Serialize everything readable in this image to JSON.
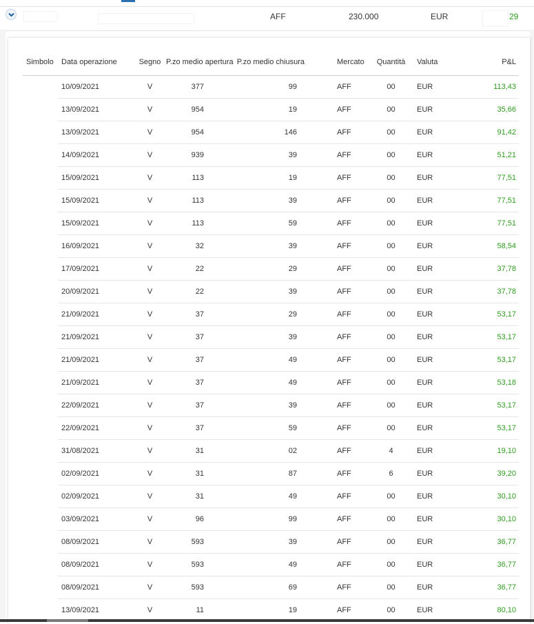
{
  "summary": {
    "market": "AFF",
    "amount": "230.000",
    "currency": "EUR",
    "pnl": "29"
  },
  "table": {
    "headers": {
      "symbol": "Simbolo",
      "date": "Data operazione",
      "sign": "Segno",
      "open_price": "P.zo medio apertura",
      "close_price": "P.zo medio chiusura",
      "market": "Mercato",
      "quantity": "Quantità",
      "currency": "Valuta",
      "pnl": "P&L"
    },
    "rows": [
      {
        "date": "10/09/2021",
        "sign": "V",
        "open": "377",
        "close": "99",
        "market": "AFF",
        "qty": "00",
        "currency": "EUR",
        "pnl": "113,43"
      },
      {
        "date": "13/09/2021",
        "sign": "V",
        "open": "954",
        "close": "19",
        "market": "AFF",
        "qty": "00",
        "currency": "EUR",
        "pnl": "35,66"
      },
      {
        "date": "13/09/2021",
        "sign": "V",
        "open": "954",
        "close": "146",
        "market": "AFF",
        "qty": "00",
        "currency": "EUR",
        "pnl": "91,42"
      },
      {
        "date": "14/09/2021",
        "sign": "V",
        "open": "939",
        "close": "39",
        "market": "AFF",
        "qty": "00",
        "currency": "EUR",
        "pnl": "51,21"
      },
      {
        "date": "15/09/2021",
        "sign": "V",
        "open": "113",
        "close": "19",
        "market": "AFF",
        "qty": "00",
        "currency": "EUR",
        "pnl": "77,51"
      },
      {
        "date": "15/09/2021",
        "sign": "V",
        "open": "113",
        "close": "39",
        "market": "AFF",
        "qty": "00",
        "currency": "EUR",
        "pnl": "77,51"
      },
      {
        "date": "15/09/2021",
        "sign": "V",
        "open": "113",
        "close": "59",
        "market": "AFF",
        "qty": "00",
        "currency": "EUR",
        "pnl": "77,51"
      },
      {
        "date": "16/09/2021",
        "sign": "V",
        "open": "32",
        "close": "39",
        "market": "AFF",
        "qty": "00",
        "currency": "EUR",
        "pnl": "58,54"
      },
      {
        "date": "17/09/2021",
        "sign": "V",
        "open": "22",
        "close": "29",
        "market": "AFF",
        "qty": "00",
        "currency": "EUR",
        "pnl": "37,78"
      },
      {
        "date": "20/09/2021",
        "sign": "V",
        "open": "22",
        "close": "39",
        "market": "AFF",
        "qty": "00",
        "currency": "EUR",
        "pnl": "37,78"
      },
      {
        "date": "21/09/2021",
        "sign": "V",
        "open": "37",
        "close": "29",
        "market": "AFF",
        "qty": "00",
        "currency": "EUR",
        "pnl": "53,17"
      },
      {
        "date": "21/09/2021",
        "sign": "V",
        "open": "37",
        "close": "39",
        "market": "AFF",
        "qty": "00",
        "currency": "EUR",
        "pnl": "53,17"
      },
      {
        "date": "21/09/2021",
        "sign": "V",
        "open": "37",
        "close": "49",
        "market": "AFF",
        "qty": "00",
        "currency": "EUR",
        "pnl": "53,17"
      },
      {
        "date": "21/09/2021",
        "sign": "V",
        "open": "37",
        "close": "49",
        "market": "AFF",
        "qty": "00",
        "currency": "EUR",
        "pnl": "53,18"
      },
      {
        "date": "22/09/2021",
        "sign": "V",
        "open": "37",
        "close": "39",
        "market": "AFF",
        "qty": "00",
        "currency": "EUR",
        "pnl": "53,17"
      },
      {
        "date": "22/09/2021",
        "sign": "V",
        "open": "37",
        "close": "59",
        "market": "AFF",
        "qty": "00",
        "currency": "EUR",
        "pnl": "53,17"
      },
      {
        "date": "31/08/2021",
        "sign": "V",
        "open": "31",
        "close": "02",
        "market": "AFF",
        "qty": "4",
        "currency": "EUR",
        "pnl": "19,10"
      },
      {
        "date": "02/09/2021",
        "sign": "V",
        "open": "31",
        "close": "87",
        "market": "AFF",
        "qty": "6",
        "currency": "EUR",
        "pnl": "39,20"
      },
      {
        "date": "02/09/2021",
        "sign": "V",
        "open": "31",
        "close": "49",
        "market": "AFF",
        "qty": "00",
        "currency": "EUR",
        "pnl": "30,10"
      },
      {
        "date": "03/09/2021",
        "sign": "V",
        "open": "96",
        "close": "99",
        "market": "AFF",
        "qty": "00",
        "currency": "EUR",
        "pnl": "30,10"
      },
      {
        "date": "08/09/2021",
        "sign": "V",
        "open": "593",
        "close": "39",
        "market": "AFF",
        "qty": "00",
        "currency": "EUR",
        "pnl": "36,77"
      },
      {
        "date": "08/09/2021",
        "sign": "V",
        "open": "593",
        "close": "49",
        "market": "AFF",
        "qty": "00",
        "currency": "EUR",
        "pnl": "36,77"
      },
      {
        "date": "08/09/2021",
        "sign": "V",
        "open": "593",
        "close": "69",
        "market": "AFF",
        "qty": "00",
        "currency": "EUR",
        "pnl": "36,77"
      },
      {
        "date": "13/09/2021",
        "sign": "V",
        "open": "11",
        "close": "19",
        "market": "AFF",
        "qty": "00",
        "currency": "EUR",
        "pnl": "80,10"
      }
    ]
  }
}
